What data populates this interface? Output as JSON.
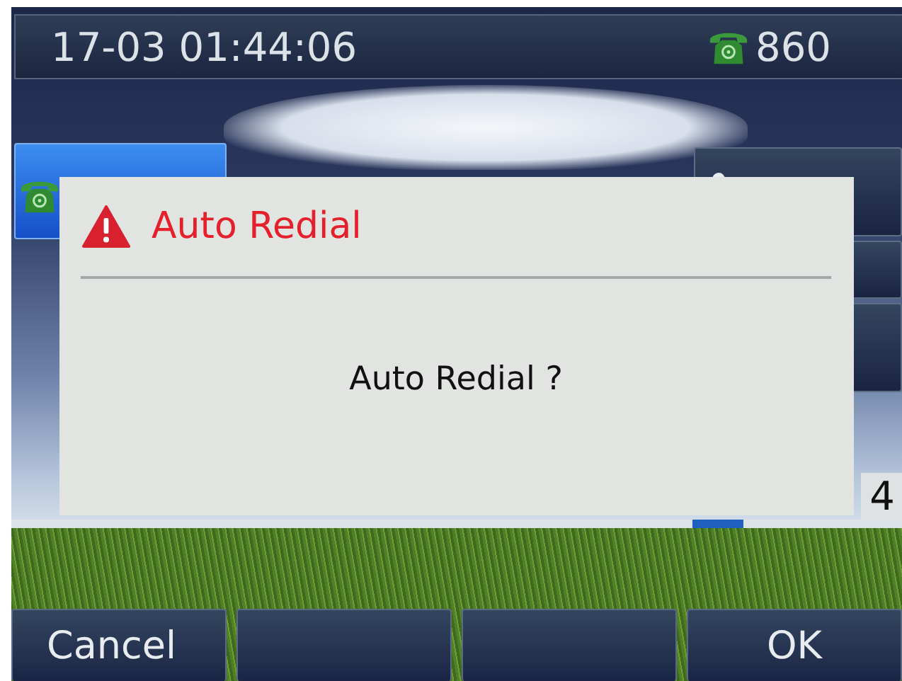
{
  "status_bar": {
    "datetime": "17-03 01:44:06",
    "account": "860"
  },
  "line_keys": {
    "left": [
      {
        "selected": true
      }
    ],
    "right": [
      {
        "selected": false
      },
      {
        "selected": false
      },
      {
        "selected": false
      }
    ]
  },
  "page_indicator": {
    "page": "4"
  },
  "dialog": {
    "title": "Auto Redial",
    "message": "Auto Redial ?"
  },
  "softkeys": [
    {
      "label": "Cancel"
    },
    {
      "label": "OK"
    }
  ]
}
